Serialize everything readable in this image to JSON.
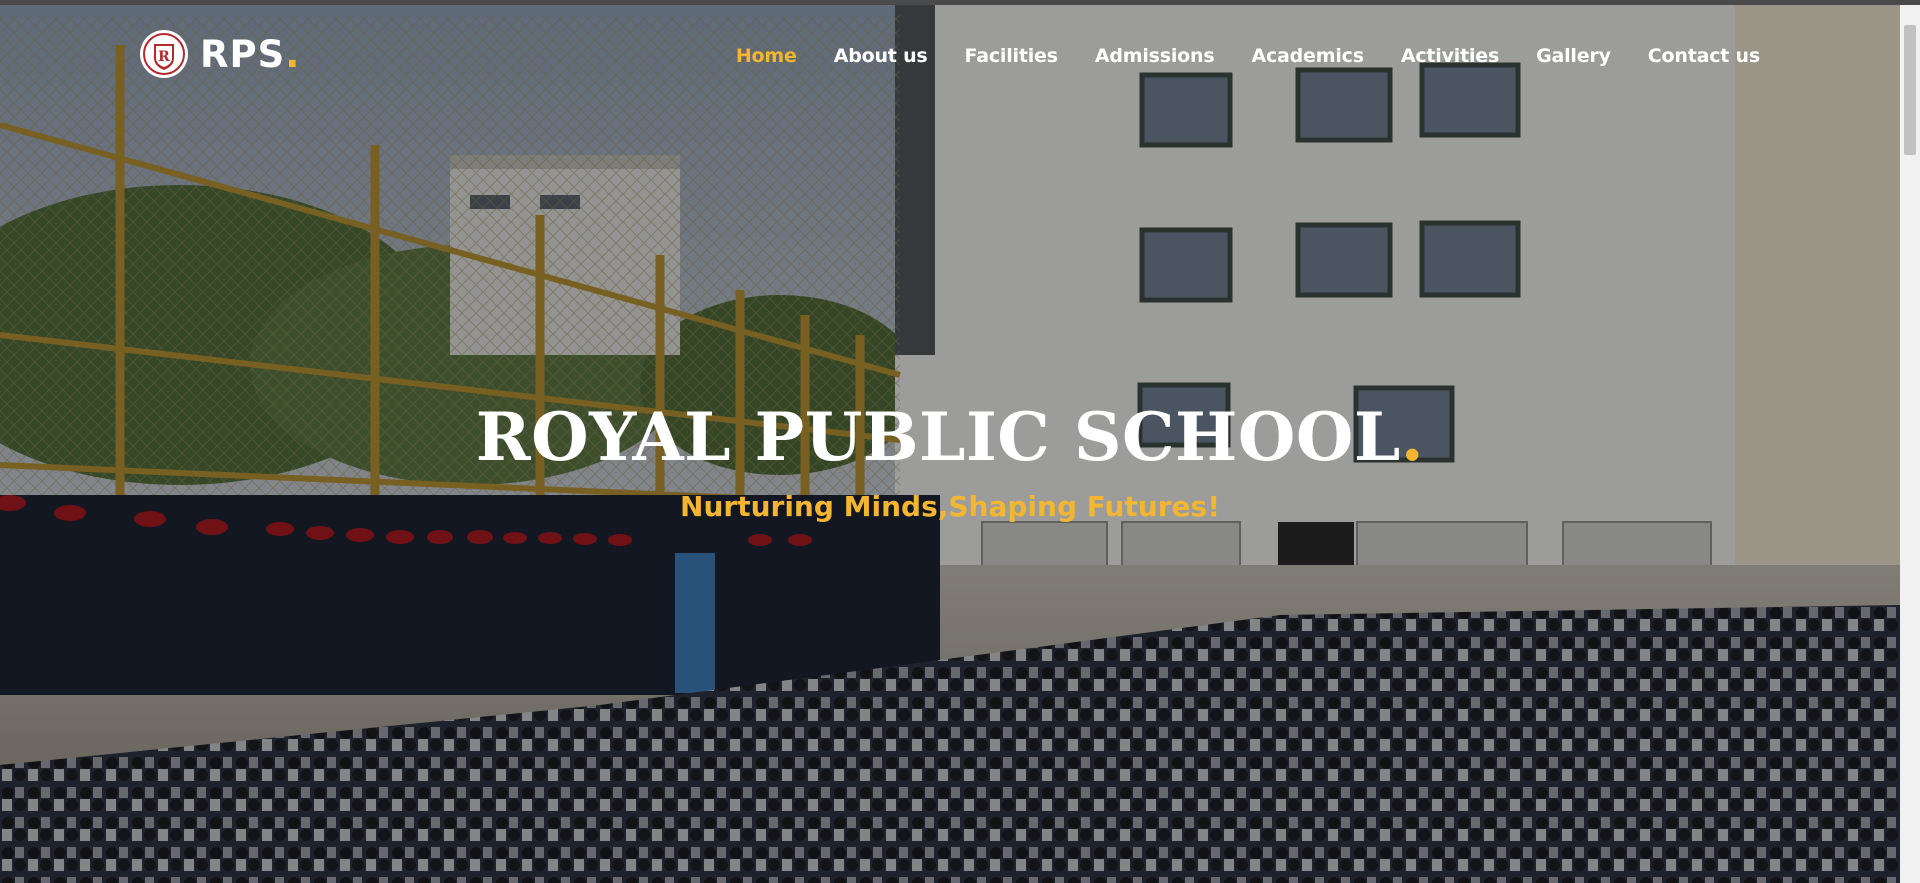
{
  "brand": {
    "name": "RPS",
    "dot": ".",
    "logo_letter": "R",
    "logo_icon": "school-crest-icon"
  },
  "nav": {
    "items": [
      {
        "label": "Home",
        "active": true
      },
      {
        "label": "About us",
        "active": false
      },
      {
        "label": "Facilities",
        "active": false
      },
      {
        "label": "Admissions",
        "active": false
      },
      {
        "label": "Academics",
        "active": false
      },
      {
        "label": "Activities",
        "active": false
      },
      {
        "label": "Gallery",
        "active": false
      },
      {
        "label": "Contact us",
        "active": false
      }
    ]
  },
  "hero": {
    "title": "ROYAL PUBLIC SCHOOL",
    "title_dot": ".",
    "subtitle": "Nurturing Minds,Shaping Futures!"
  },
  "colors": {
    "accent": "#f2b632",
    "text": "#ffffff",
    "logo_red": "#b22a2e"
  }
}
